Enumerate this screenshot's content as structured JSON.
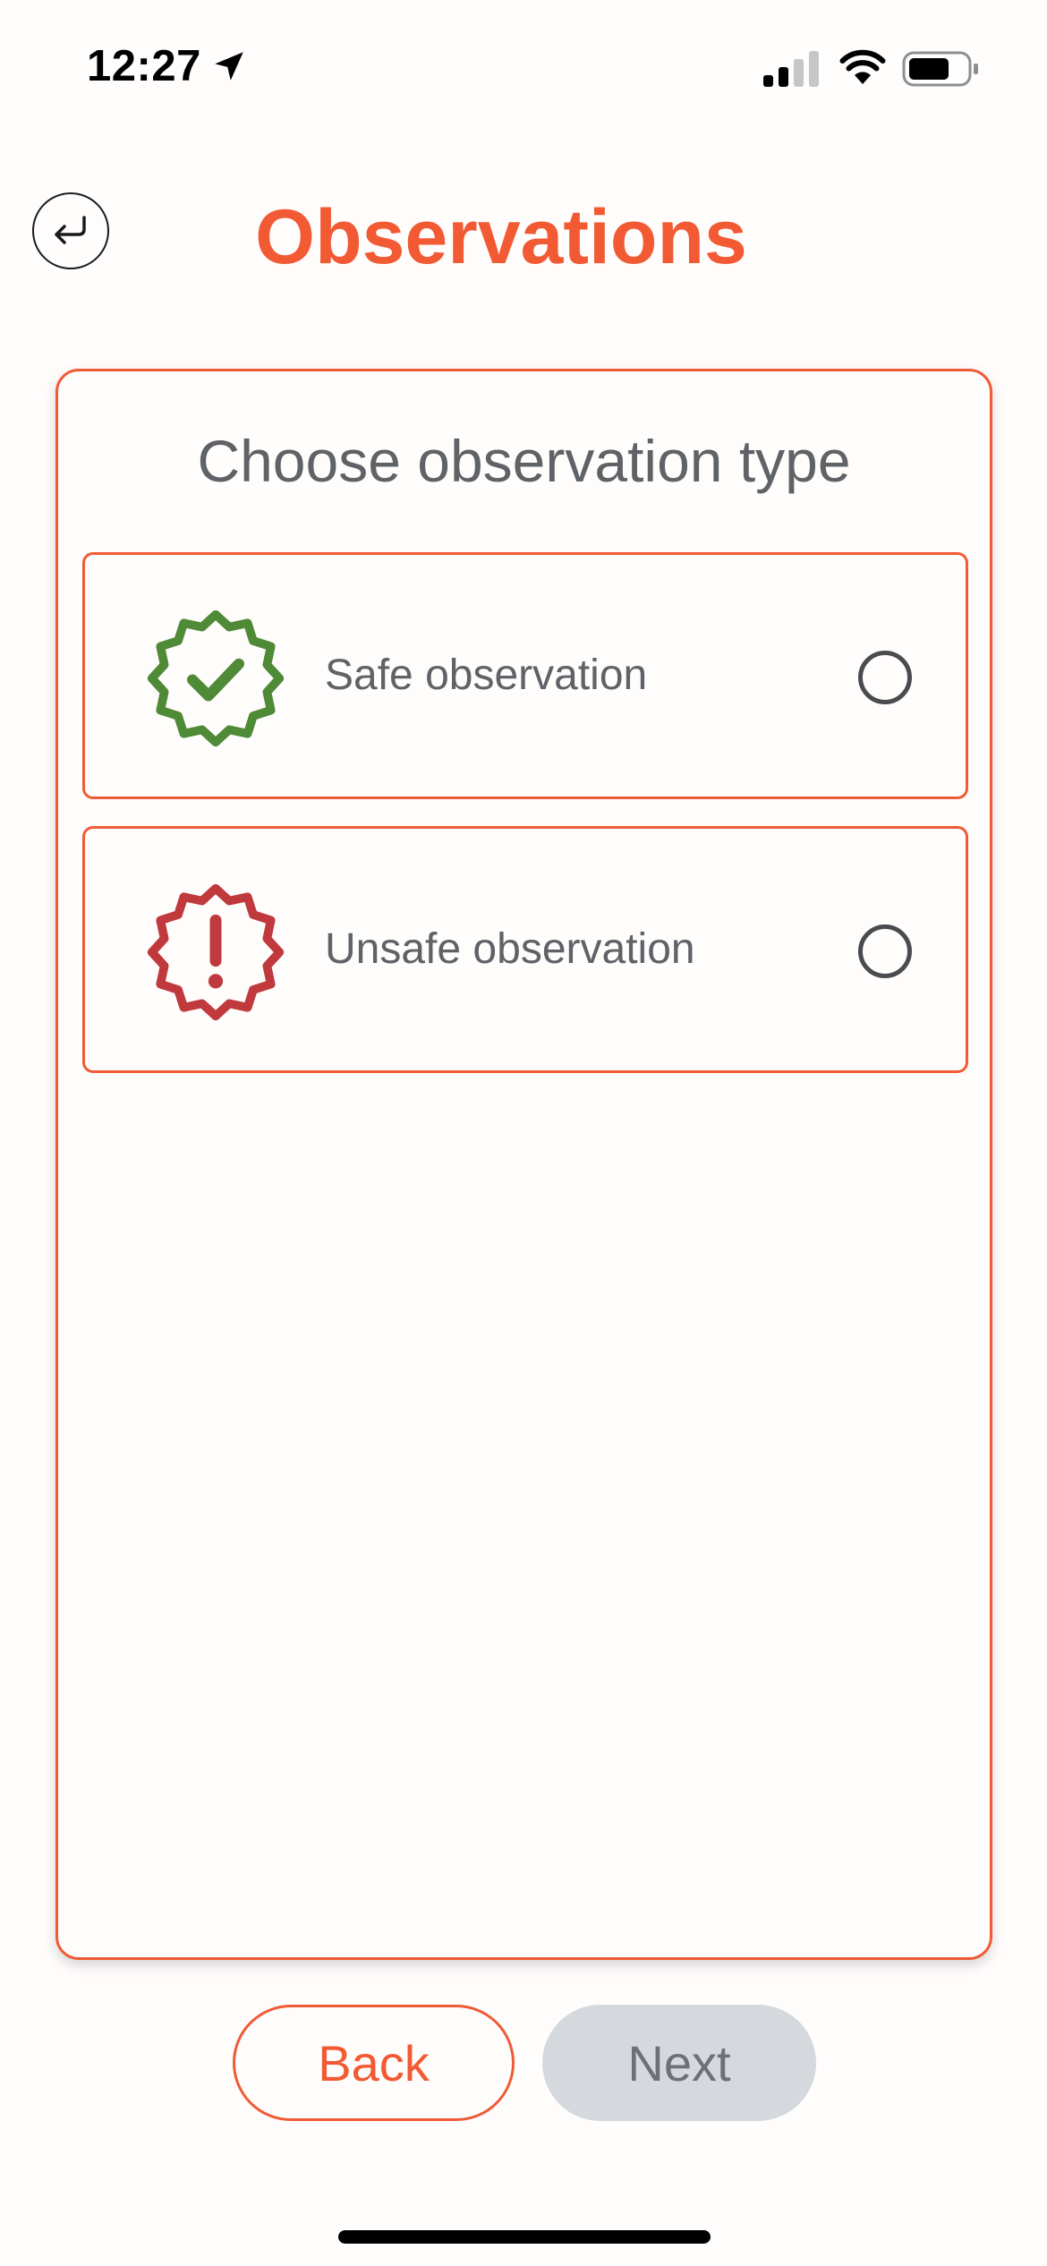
{
  "status_bar": {
    "time": "12:27",
    "icons": [
      "location-arrow-icon",
      "cellular-signal-icon",
      "wifi-icon",
      "battery-icon"
    ]
  },
  "header": {
    "title": "Observations",
    "back_icon": "return-arrow-icon"
  },
  "card": {
    "title": "Choose observation type",
    "options": [
      {
        "label": "Safe observation",
        "icon": "verified-badge-check-icon",
        "color": "#4f8a36",
        "selected": false
      },
      {
        "label": "Unsafe observation",
        "icon": "badge-alert-icon",
        "color": "#c0393c",
        "selected": false
      }
    ]
  },
  "buttons": {
    "back_label": "Back",
    "next_label": "Next",
    "next_enabled": false
  },
  "colors": {
    "accent": "#f25a33",
    "safe": "#4f8a36",
    "unsafe": "#c0393c",
    "disabled_button": "#d5d9de",
    "text_muted": "#5f6266"
  }
}
